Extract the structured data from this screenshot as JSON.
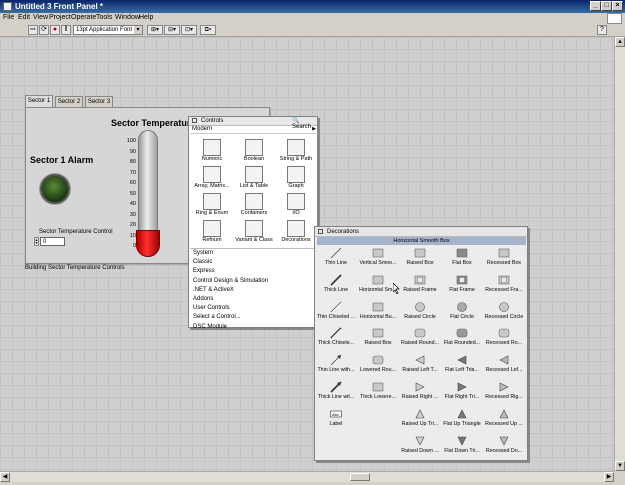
{
  "window": {
    "title": "Untitled 3 Front Panel *"
  },
  "menu": [
    "File",
    "Edit",
    "View",
    "Project",
    "Operate",
    "Tools",
    "Window",
    "Help"
  ],
  "toolbar": {
    "font": "13pt Application Font"
  },
  "tabs": [
    "Sector 1",
    "Sector 2",
    "Sector 3"
  ],
  "panel": {
    "alarm_title": "Sector 1 Alarm",
    "therm_title": "Sector Temperature",
    "scale": [
      "100",
      "90",
      "80",
      "70",
      "60",
      "50",
      "40",
      "30",
      "20",
      "10",
      "0"
    ],
    "control_label": "Sector Temperature Control",
    "control_value": "0",
    "caption": "Building Sector Temperature Controls"
  },
  "controls_palette": {
    "title": "Controls",
    "search": "Search",
    "category": "Modern",
    "items": [
      {
        "label": "Numeric",
        "icon": "numeric-icon"
      },
      {
        "label": "Boolean",
        "icon": "boolean-icon"
      },
      {
        "label": "String & Path",
        "icon": "string-path-icon"
      },
      {
        "label": "Array, Matrix...",
        "icon": "array-icon"
      },
      {
        "label": "List & Table",
        "icon": "list-table-icon"
      },
      {
        "label": "Graph",
        "icon": "graph-icon"
      },
      {
        "label": "Ring & Enum",
        "icon": "ring-enum-icon"
      },
      {
        "label": "Containers",
        "icon": "containers-icon"
      },
      {
        "label": "I/O",
        "icon": "io-icon"
      },
      {
        "label": "Refnum",
        "icon": "refnum-icon"
      },
      {
        "label": "Variant & Class",
        "icon": "variant-icon"
      },
      {
        "label": "Decorations",
        "icon": "decorations-icon"
      }
    ],
    "list": [
      "System",
      "Classic",
      "Express",
      "Control Design & Simulation",
      ".NET & ActiveX",
      "Addons",
      "User Controls",
      "Select a Control...",
      "DSC Module"
    ]
  },
  "decorations_palette": {
    "title": "Decorations",
    "header": "Horizontal Smooth Box",
    "items": [
      "Thin Line",
      "Vertical Smoo...",
      "Raised Box",
      "Flat Box",
      "Recessed Box",
      "Thick Line",
      "Horizontal Sm...",
      "Raised Frame",
      "Flat Frame",
      "Recessed Fra...",
      "Thin Chiseled ...",
      "Horizontal Bu...",
      "Raised Circle",
      "Flat Circle",
      "Recessed Circle",
      "Thick Chisele...",
      "Raised Box",
      "Raised Round...",
      "Flat Rounded...",
      "Recessed Ro...",
      "Thin Line with...",
      "Lowered Rou...",
      "Raised Left T...",
      "Flat Left Tria...",
      "Recessed Lef...",
      "Thick Line wit...",
      "Thick Lowere...",
      "Raised Right ...",
      "Flat Right Tri...",
      "Recessed Rig...",
      "Label",
      "",
      "Raised Up Tri...",
      "Flat Up Triangle",
      "Recessed Up ...",
      "",
      "",
      "Raised Down ...",
      "Flat Down Tri...",
      "Recessed Do..."
    ]
  }
}
